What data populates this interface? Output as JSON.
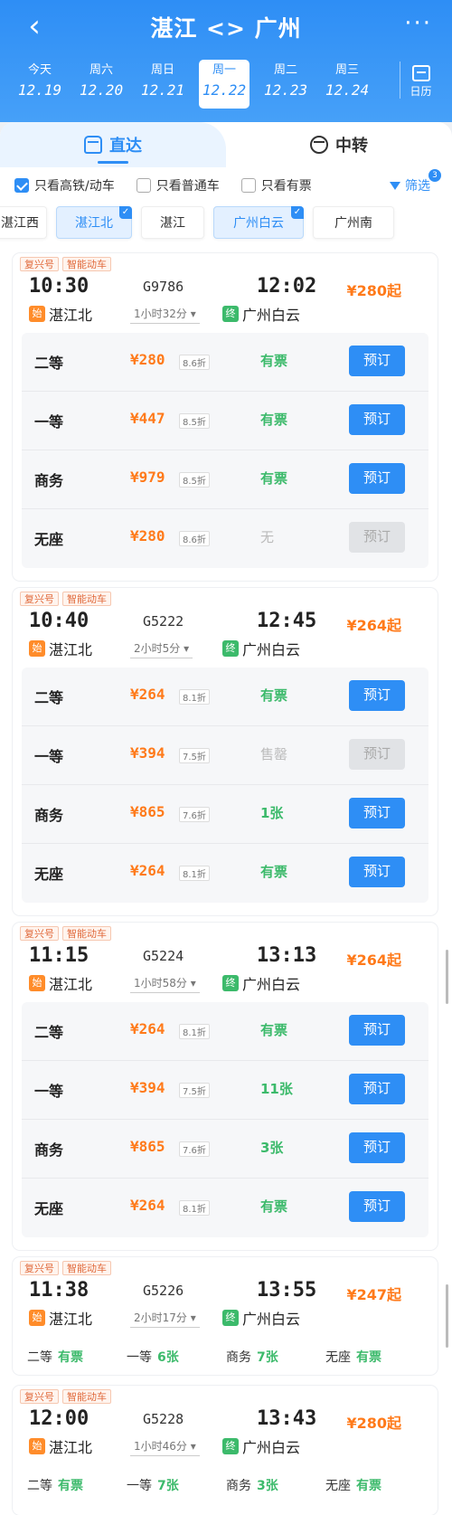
{
  "header": {
    "title": "湛江 <> 广州",
    "back_icon": "back-arrow-icon",
    "more_icon": "more-icon"
  },
  "dates": [
    {
      "week": "今天",
      "date": "12.19"
    },
    {
      "week": "周六",
      "date": "12.20"
    },
    {
      "week": "周日",
      "date": "12.21"
    },
    {
      "week": "周一",
      "date": "12.22",
      "selected": true
    },
    {
      "week": "周二",
      "date": "12.23"
    },
    {
      "week": "周三",
      "date": "12.24"
    }
  ],
  "calendar_label": "日历",
  "tabs": {
    "direct": "直达",
    "transfer": "中转"
  },
  "filters": {
    "high_speed": "只看高铁/动车",
    "normal": "只看普通车",
    "available": "只看有票",
    "screen": "筛选",
    "screen_count": "3"
  },
  "stations": [
    "湛江西",
    "湛江北",
    "湛江",
    "广州白云",
    "广州南"
  ],
  "tags": {
    "fuxing": "复兴号",
    "smart": "智能动车"
  },
  "start_mark": "始",
  "end_mark": "终",
  "trains": [
    {
      "depart": "10:30",
      "number": "G9786",
      "arrive": "12:02",
      "price": "¥280起",
      "from": "湛江北",
      "to": "广州白云",
      "duration": "1小时32分",
      "seats": [
        {
          "name": "二等",
          "price": "¥280",
          "discount": "8.6折",
          "avail": "有票",
          "book": "预订"
        },
        {
          "name": "一等",
          "price": "¥447",
          "discount": "8.5折",
          "avail": "有票",
          "book": "预订"
        },
        {
          "name": "商务",
          "price": "¥979",
          "discount": "8.5折",
          "avail": "有票",
          "book": "预订"
        },
        {
          "name": "无座",
          "price": "¥280",
          "discount": "8.6折",
          "avail": "无",
          "book": "预订"
        }
      ]
    },
    {
      "depart": "10:40",
      "number": "G5222",
      "arrive": "12:45",
      "price": "¥264起",
      "from": "湛江北",
      "to": "广州白云",
      "duration": "2小时5分",
      "seats": [
        {
          "name": "二等",
          "price": "¥264",
          "discount": "8.1折",
          "avail": "有票",
          "book": "预订"
        },
        {
          "name": "一等",
          "price": "¥394",
          "discount": "7.5折",
          "avail": "售罄",
          "book": "预订"
        },
        {
          "name": "商务",
          "price": "¥865",
          "discount": "7.6折",
          "avail": "1张",
          "book": "预订"
        },
        {
          "name": "无座",
          "price": "¥264",
          "discount": "8.1折",
          "avail": "有票",
          "book": "预订"
        }
      ]
    },
    {
      "depart": "11:15",
      "number": "G5224",
      "arrive": "13:13",
      "price": "¥264起",
      "from": "湛江北",
      "to": "广州白云",
      "duration": "1小时58分",
      "seats": [
        {
          "name": "二等",
          "price": "¥264",
          "discount": "8.1折",
          "avail": "有票",
          "book": "预订"
        },
        {
          "name": "一等",
          "price": "¥394",
          "discount": "7.5折",
          "avail": "11张",
          "book": "预订"
        },
        {
          "name": "商务",
          "price": "¥865",
          "discount": "7.6折",
          "avail": "3张",
          "book": "预订"
        },
        {
          "name": "无座",
          "price": "¥264",
          "discount": "8.1折",
          "avail": "有票",
          "book": "预订"
        }
      ]
    },
    {
      "depart": "11:38",
      "number": "G5226",
      "arrive": "13:55",
      "price": "¥247起",
      "from": "湛江北",
      "to": "广州白云",
      "duration": "2小时17分",
      "summary": [
        {
          "name": "二等",
          "avail": "有票"
        },
        {
          "name": "一等",
          "avail": "6张"
        },
        {
          "name": "商务",
          "avail": "7张"
        },
        {
          "name": "无座",
          "avail": "有票"
        }
      ]
    },
    {
      "depart": "12:00",
      "number": "G5228",
      "arrive": "13:43",
      "price": "¥280起",
      "from": "湛江北",
      "to": "广州白云",
      "duration": "1小时46分",
      "summary": [
        {
          "name": "二等",
          "avail": "有票"
        },
        {
          "name": "一等",
          "avail": "7张"
        },
        {
          "name": "商务",
          "avail": "3张"
        },
        {
          "name": "无座",
          "avail": "有票"
        }
      ]
    }
  ]
}
